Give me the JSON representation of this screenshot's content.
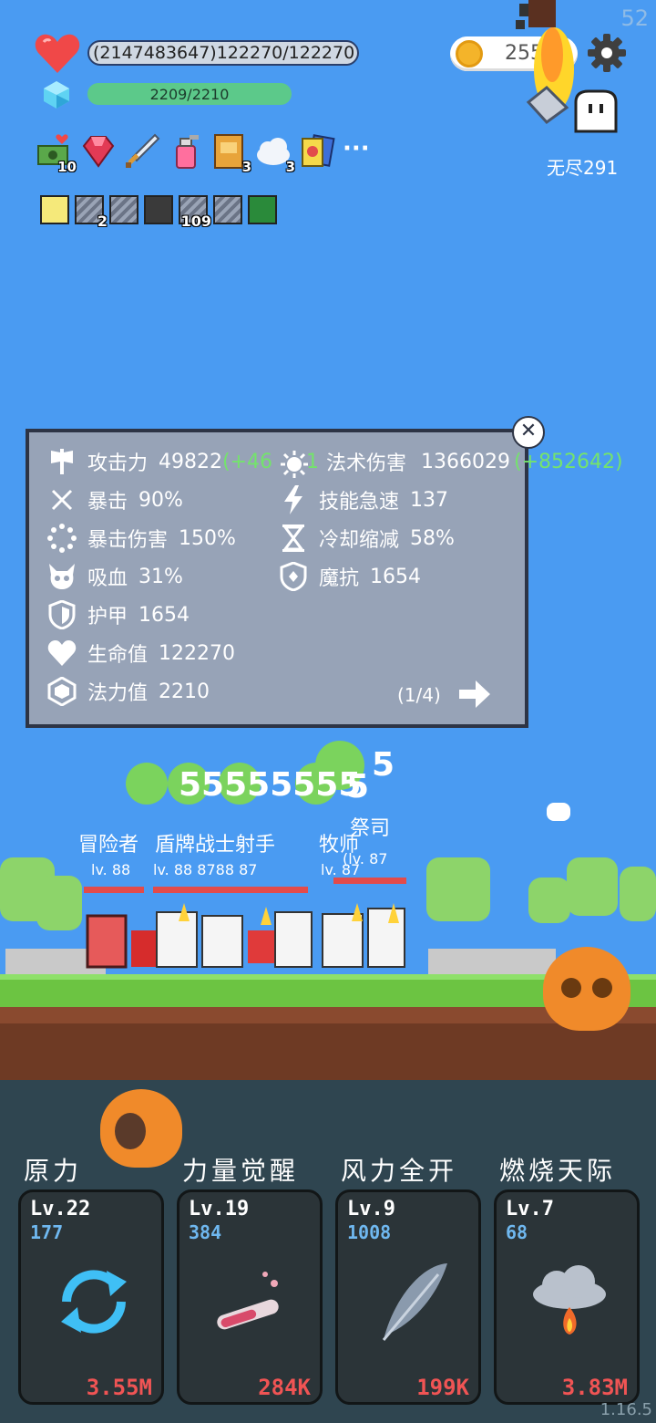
{
  "fps": "52",
  "hud": {
    "hp_text": "(2147483647)122270/122270",
    "mp_text": "2209/2210",
    "mp_fraction": 0.9995,
    "coins": "255",
    "mode": "无尽291"
  },
  "items_row1": [
    {
      "icon": "money-heart-icon",
      "count": "10"
    },
    {
      "icon": "ruby-icon",
      "count": ""
    },
    {
      "icon": "sword-icon",
      "count": ""
    },
    {
      "icon": "potion-spray-icon",
      "count": ""
    },
    {
      "icon": "book-icon",
      "count": "3"
    },
    {
      "icon": "cloud-icon",
      "count": "3"
    },
    {
      "icon": "cards-icon",
      "count": ""
    }
  ],
  "more_label": "···",
  "items_row2": [
    {
      "icon": "light-bulb-icon",
      "count": ""
    },
    {
      "icon": "equip-slot-icon",
      "count": "2"
    },
    {
      "icon": "equip-slot-icon",
      "count": ""
    },
    {
      "icon": "armor-icon",
      "count": ""
    },
    {
      "icon": "equip-slot-icon",
      "count": "109"
    },
    {
      "icon": "equip-slot-icon",
      "count": ""
    },
    {
      "icon": "rune-icon",
      "count": ""
    }
  ],
  "stats": {
    "attack_label": "攻击力",
    "attack_value": "49822",
    "attack_bonus": "(+46",
    "attack_bonus2": "1",
    "magic_label": "法术伤害",
    "magic_value": "1366029",
    "magic_bonus": "(+852642)",
    "crit_label": "暴击",
    "crit_value": "90%",
    "haste_label": "技能急速",
    "haste_value": "137",
    "critdmg_label": "暴击伤害",
    "critdmg_value": "150%",
    "cdr_label": "冷却缩减",
    "cdr_value": "58%",
    "lifesteal_label": "吸血",
    "lifesteal_value": "31%",
    "mres_label": "魔抗",
    "mres_value": "1654",
    "armor_label": "护甲",
    "armor_value": "1654",
    "hp_label": "生命值",
    "hp_value": "122270",
    "mana_label": "法力值",
    "mana_value": "2210",
    "page": "(1/4)"
  },
  "battle": {
    "names_left": "冒险者",
    "names_mid": "盾牌战士射手",
    "names_right": "牧师",
    "name_priest": "祭司",
    "lv1": "lv. 88",
    "lv2": "lv. 88 8788 87",
    "lv3": "lv. 87",
    "lv4": "(lv. 87",
    "damage": [
      "55555555",
      "5",
      "5"
    ]
  },
  "skills": [
    {
      "title": "原力",
      "level": "Lv.22",
      "value": "177",
      "cost": "3.55M",
      "icon": "cycle-icon"
    },
    {
      "title": "力量觉醒",
      "level": "Lv.19",
      "value": "384",
      "cost": "284K",
      "icon": "test-tube-icon"
    },
    {
      "title": "风力全开",
      "level": "Lv.9",
      "value": "1008",
      "cost": "199K",
      "icon": "feather-icon"
    },
    {
      "title": "燃烧天际",
      "level": "Lv.7",
      "value": "68",
      "cost": "3.83M",
      "icon": "fire-cloud-icon"
    }
  ],
  "version": "1.16.5",
  "colors": {
    "sky": "#4a9bf2",
    "panel": "#97a3b7",
    "bonus": "#74e36c",
    "cost": "#f05454"
  }
}
